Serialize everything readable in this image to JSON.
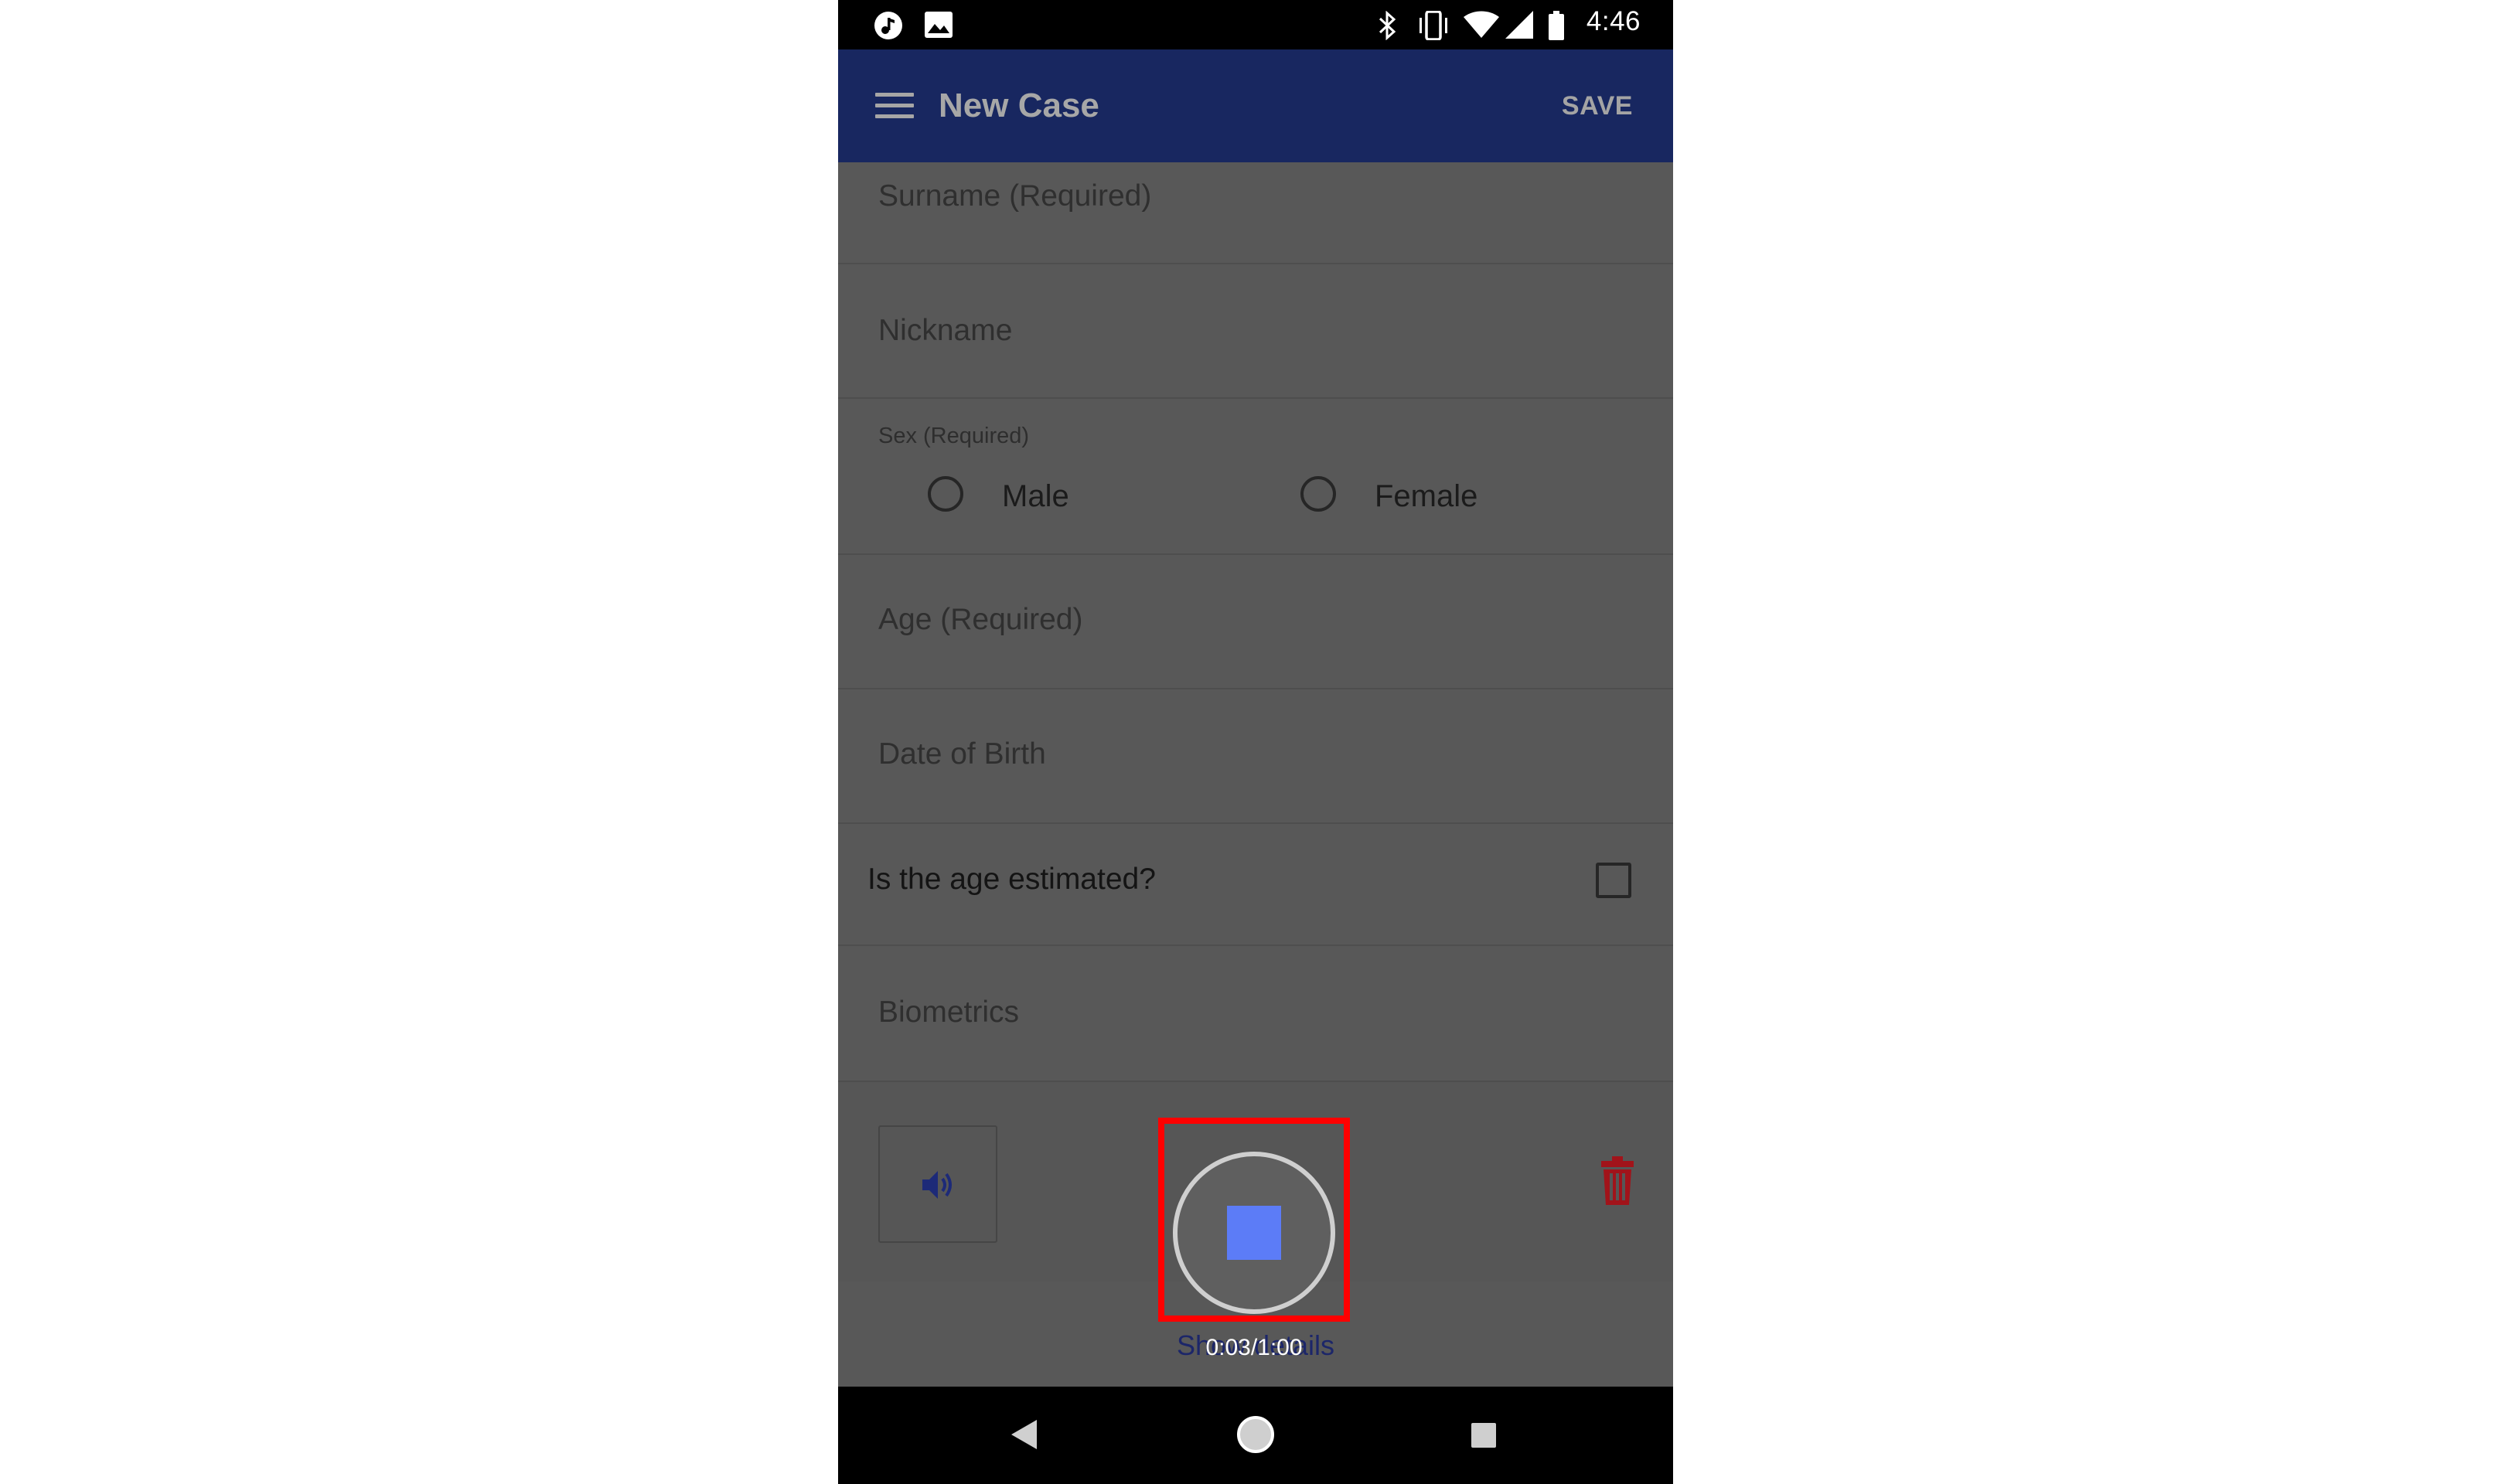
{
  "status_bar": {
    "time": "4:46",
    "left_icons": [
      "music-note-icon",
      "image-icon"
    ],
    "right_icons": [
      "bluetooth-icon",
      "vibrate-icon",
      "wifi-icon",
      "signal-icon",
      "battery-icon"
    ]
  },
  "app_bar": {
    "title": "New Case",
    "save_label": "SAVE",
    "color": "#182760"
  },
  "form": {
    "surname_placeholder": "Surname (Required)",
    "nickname_placeholder": "Nickname",
    "sex_label": "Sex (Required)",
    "sex_options": [
      {
        "label": "Male",
        "selected": false
      },
      {
        "label": "Female",
        "selected": false
      }
    ],
    "age_placeholder": "Age (Required)",
    "dob_placeholder": "Date of Birth",
    "age_estimated_label": "Is the age estimated?",
    "age_estimated_checked": false,
    "biometrics_label": "Biometrics"
  },
  "audio": {
    "speaker_icon": "speaker-icon",
    "trash_icon": "trash-icon",
    "trash_color": "#a1131a",
    "show_details_text": "Show details",
    "record_state": "recording",
    "stop_color": "#5c7cf7",
    "timer": "0:03/1:00",
    "highlight_color": "#ff0000"
  },
  "nav_bar": {
    "buttons": [
      "back-icon",
      "home-icon",
      "recents-icon"
    ]
  }
}
